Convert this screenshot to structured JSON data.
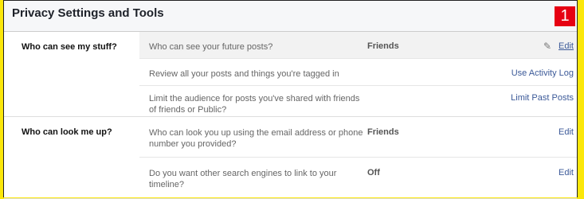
{
  "header": {
    "title": "Privacy Settings and Tools",
    "badge": "1"
  },
  "sections": [
    {
      "label": "Who can see my stuff?",
      "rows": [
        {
          "question": "Who can see your future posts?",
          "value": "Friends",
          "action": "Edit",
          "icon": "pencil-icon"
        },
        {
          "question": "Review all your posts and things you're tagged in",
          "value": "",
          "action": "Use Activity Log"
        },
        {
          "question": "Limit the audience for posts you've shared with friends of friends or Public?",
          "value": "",
          "action": "Limit Past Posts"
        }
      ]
    },
    {
      "label": "Who can look me up?",
      "rows": [
        {
          "question": "Who can look you up using the email address or phone number you provided?",
          "value": "Friends",
          "action": "Edit"
        },
        {
          "question": "Do you want other search engines to link to your timeline?",
          "value": "Off",
          "action": "Edit"
        }
      ]
    }
  ]
}
